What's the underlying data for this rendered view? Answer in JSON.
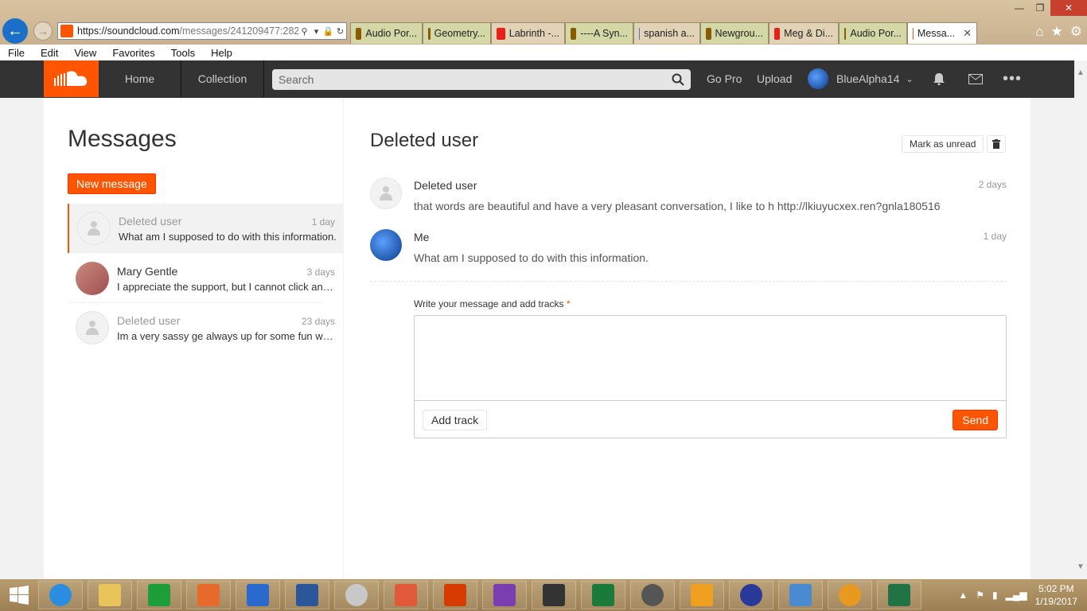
{
  "browser": {
    "url_main": "https://soundcloud.com",
    "url_rest": "/messages/241209477:282(",
    "tabs": [
      {
        "label": "Audio Por...",
        "kind": "ng"
      },
      {
        "label": "Geometry...",
        "kind": "ng"
      },
      {
        "label": "Labrinth -...",
        "kind": "yt"
      },
      {
        "label": "----A Syn...",
        "kind": "ng"
      },
      {
        "label": "spanish a...",
        "kind": "gg"
      },
      {
        "label": "Newgrou...",
        "kind": "ng"
      },
      {
        "label": "Meg & Di...",
        "kind": "yt"
      },
      {
        "label": "Audio Por...",
        "kind": "ng"
      },
      {
        "label": "Messa...",
        "kind": "sc"
      }
    ],
    "menu": [
      "File",
      "Edit",
      "View",
      "Favorites",
      "Tools",
      "Help"
    ]
  },
  "header": {
    "nav": [
      "Home",
      "Collection"
    ],
    "search_placeholder": "Search",
    "go_pro": "Go Pro",
    "upload": "Upload",
    "username": "BlueAlpha14"
  },
  "sidebar": {
    "title": "Messages",
    "new_message": "New message",
    "threads": [
      {
        "name": "Deleted user",
        "when": "1 day",
        "preview": "What am I supposed to do with this information.",
        "active": true
      },
      {
        "name": "Mary Gentle",
        "when": "3 days",
        "preview": "I appreciate the support, but I cannot click any of those links.",
        "active": false
      },
      {
        "name": "Deleted user",
        "when": "23 days",
        "preview": "Im a very sassy ge always up for some fun with anyone.",
        "active": false
      }
    ]
  },
  "conversation": {
    "title": "Deleted user",
    "mark_unread": "Mark as unread",
    "messages": [
      {
        "name": "Deleted user",
        "when": "2 days",
        "body": "that words are beautiful and have a very pleasant conversation, I like to h http://lkiuyucxex.ren?gnla180516"
      },
      {
        "name": "Me",
        "when": "1 day",
        "body": "What am I supposed to do with this information."
      }
    ],
    "compose_label": "Write your message and add tracks",
    "required_mark": "*",
    "add_track": "Add track",
    "send": "Send"
  },
  "taskbar": {
    "time": "5:02 PM",
    "date": "1/19/2017"
  },
  "colors": {
    "accent": "#ff5500",
    "header_bg": "#333333"
  }
}
